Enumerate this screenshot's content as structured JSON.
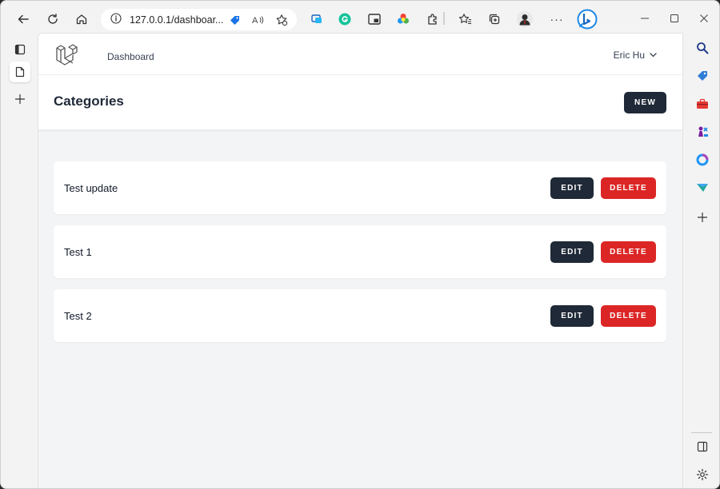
{
  "browser": {
    "url": "127.0.0.1/dashboar...",
    "more_label": "···"
  },
  "app": {
    "nav": {
      "dashboard_label": "Dashboard",
      "user_name": "Eric Hu"
    },
    "header": {
      "title": "Categories",
      "new_button": "NEW"
    },
    "categories": [
      {
        "name": "Test update",
        "edit_label": "EDIT",
        "delete_label": "DELETE"
      },
      {
        "name": "Test 1",
        "edit_label": "EDIT",
        "delete_label": "DELETE"
      },
      {
        "name": "Test 2",
        "edit_label": "EDIT",
        "delete_label": "DELETE"
      }
    ]
  },
  "colors": {
    "primary_dark": "#1f2937",
    "danger": "#dc2626",
    "page_bg": "#f3f4f6",
    "laravel_logo": "#555555"
  }
}
